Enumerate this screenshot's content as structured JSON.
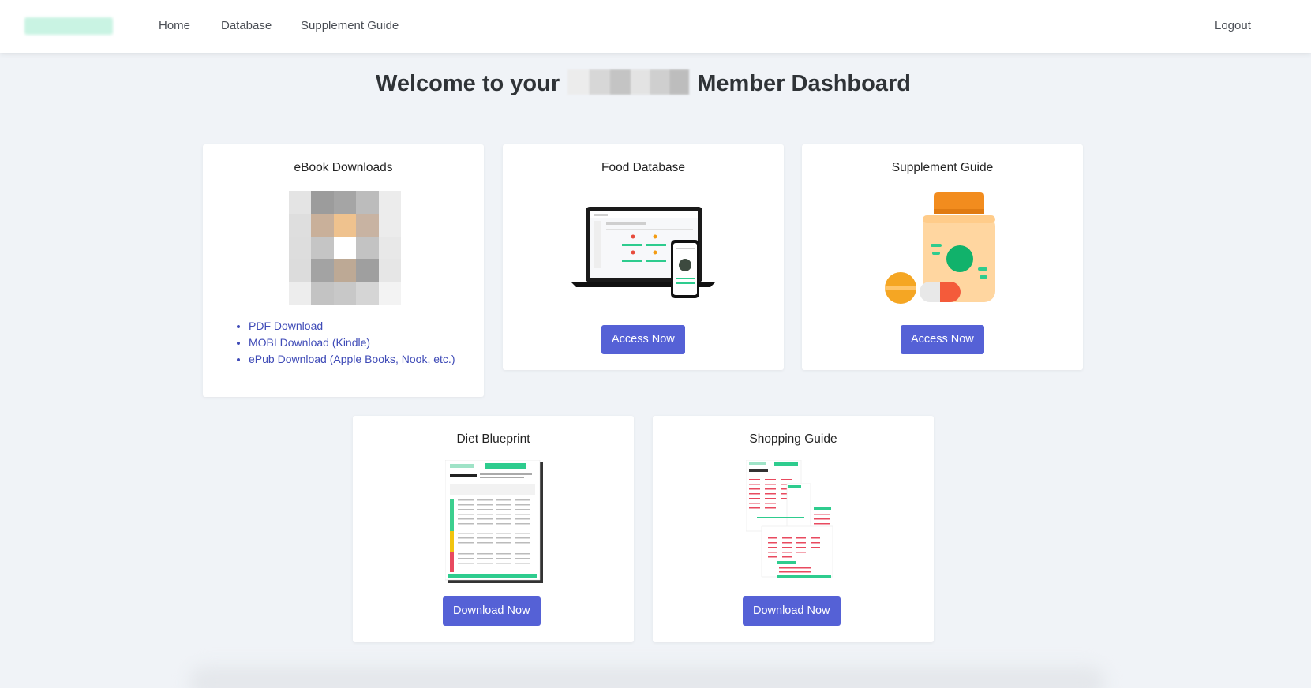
{
  "nav": {
    "links": [
      "Home",
      "Database",
      "Supplement Guide"
    ],
    "logout": "Logout"
  },
  "page": {
    "title_prefix": "Welcome to your",
    "title_suffix": "Member Dashboard"
  },
  "cards": {
    "ebook": {
      "title": "eBook Downloads",
      "links": [
        "PDF Download",
        "MOBI Download (Kindle)",
        "ePub Download (Apple Books, Nook, etc.)"
      ]
    },
    "food": {
      "title": "Food Database",
      "button": "Access Now"
    },
    "supplement": {
      "title": "Supplement Guide",
      "button": "Access Now"
    },
    "diet": {
      "title": "Diet Blueprint",
      "button": "Download Now"
    },
    "shopping": {
      "title": "Shopping Guide",
      "button": "Download Now"
    }
  },
  "colors": {
    "primary_button": "#5561d6",
    "link": "#3f4bb7",
    "background": "#f0f3f7",
    "accent_green": "#2ecc8e"
  }
}
